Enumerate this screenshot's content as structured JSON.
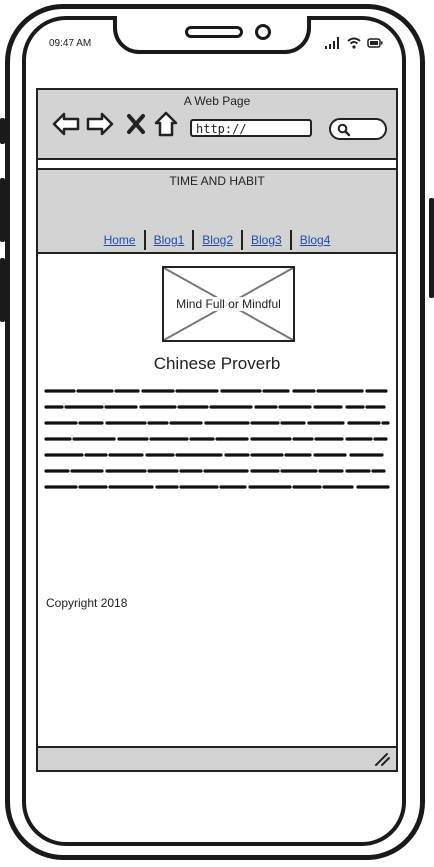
{
  "status_bar": {
    "time": "09:47 AM"
  },
  "browser": {
    "window_title": "A Web Page",
    "url": "http://"
  },
  "site": {
    "title": "TIME AND HABIT",
    "nav": [
      "Home",
      "Blog1",
      "Blog2",
      "Blog3",
      "Blog4"
    ],
    "hero_caption": "Mind Full or Mindful",
    "quote_title": "Chinese Proverb",
    "copyright": "Copyright 2018"
  },
  "colors": {
    "chrome": "#d3d3d3",
    "link": "#1f4fa8",
    "ink": "#222222"
  },
  "icons": [
    "back-arrow-icon",
    "forward-arrow-icon",
    "stop-x-icon",
    "home-icon",
    "search-icon",
    "resize-grip-icon",
    "signal-icon",
    "wifi-icon",
    "battery-icon"
  ]
}
